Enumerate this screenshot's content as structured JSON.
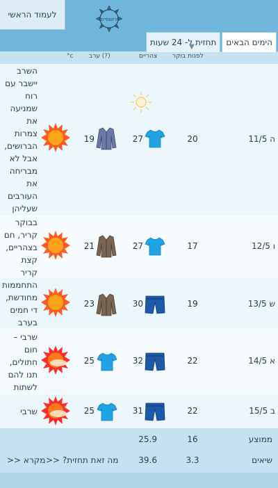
{
  "header": {
    "home_label": "לעמוד הראשי",
    "logo_text": "ירושמיים",
    "tabs": [
      {
        "label": "הימים הבאים"
      },
      {
        "label": "תחזית ל- 24 שעות"
      }
    ]
  },
  "table": {
    "columns": {
      "morning": "לפנות בוקר",
      "noon": "צהריים",
      "evening": "ערב (?)",
      "unit": "°c"
    },
    "rows": [
      {
        "day": "ה 11/5",
        "morning": "20",
        "noon": "27",
        "evening": "19",
        "noon_clothing": "tshirt-icon",
        "evening_clothing": "jacket-icon",
        "weather_icon": "sun-icon",
        "desc": "השרב יישבר עם רוח שמניעה את צמרות הברושים, אבל לא מבריחה את העורבים שעליהן"
      },
      {
        "day": "ו 12/5",
        "morning": "17",
        "noon": "27",
        "evening": "21",
        "noon_clothing": "tshirt-icon",
        "evening_clothing": "jacket-icon",
        "weather_icon": "sun-icon",
        "desc": "בבוקר קריר, חם בצהריים, קצת קריר בערב"
      },
      {
        "day": "ש 13/5",
        "morning": "19",
        "noon": "30",
        "evening": "23",
        "noon_clothing": "shorts-icon",
        "evening_clothing": "jacket-icon",
        "weather_icon": "sun-icon",
        "desc": "התחממות מחודשת, די חמים בערב"
      },
      {
        "day": "א 14/5",
        "morning": "22",
        "noon": "32",
        "evening": "25",
        "noon_clothing": "shorts-icon",
        "evening_clothing": "tshirt-icon",
        "weather_icon": "sun-haze-icon",
        "desc": "שרבי – חום חתולים, תנו להם לשתות"
      },
      {
        "day": "ב 15/5",
        "morning": "22",
        "noon": "31",
        "evening": "25",
        "noon_clothing": "shorts-icon",
        "evening_clothing": "tshirt-icon",
        "weather_icon": "sun-haze-icon",
        "desc": "שרבי"
      }
    ],
    "average": {
      "label": "ממוצע",
      "morning": "16",
      "noon": "25.9"
    },
    "peaks": {
      "label": "שיאים",
      "morning": "3.3",
      "noon": "39.6"
    }
  },
  "links": {
    "what_is": "מה זאת תחזית? <<",
    "legend": "מקרא <<"
  }
}
